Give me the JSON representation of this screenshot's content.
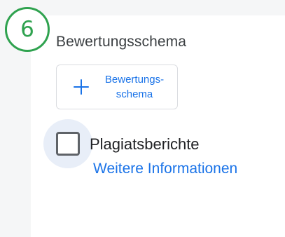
{
  "step_badge": {
    "number": "6",
    "color": "#2fa24f"
  },
  "rubric": {
    "title": "Bewertungsschema",
    "add_button": {
      "icon": "plus-icon",
      "label": "Bewertungs-\nschema"
    }
  },
  "plagiarism": {
    "label": "Plagiatsberichte",
    "checked": false,
    "link_text": "Weitere Informationen"
  },
  "colors": {
    "accent": "#1a73e8",
    "text": "#202124",
    "checkbox_border": "#5f6368"
  }
}
